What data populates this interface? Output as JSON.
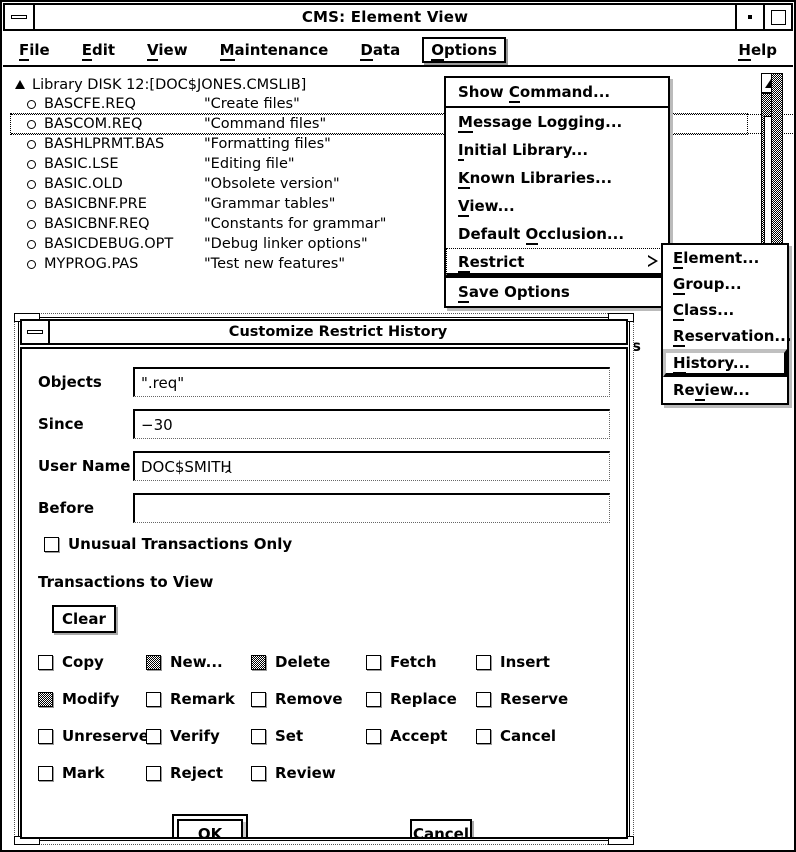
{
  "main_window": {
    "title": "CMS: Element View",
    "window_menu_icon": "window-menu-icon",
    "minimize_icon": "minimize-icon",
    "maximize_icon": "maximize-icon",
    "menubar": [
      {
        "label": "File",
        "mnemonic": "F"
      },
      {
        "label": "Edit",
        "mnemonic": "E"
      },
      {
        "label": "View",
        "mnemonic": "V"
      },
      {
        "label": "Maintenance",
        "mnemonic": "M"
      },
      {
        "label": "Data",
        "mnemonic": "D"
      },
      {
        "label": "Options",
        "mnemonic": "O",
        "active": true
      },
      {
        "label": "Help",
        "mnemonic": "H"
      }
    ],
    "library": {
      "label": "Library DISK 12:[DOC$JONES.CMSLIB]",
      "expander_icon": "triangle-expander-icon"
    },
    "files": [
      {
        "name": "BASCFE.REQ",
        "desc": "\"Create files\"",
        "selected": false
      },
      {
        "name": "BASCOM.REQ",
        "desc": "\"Command files\"",
        "selected": true
      },
      {
        "name": "BASHLPRMT.BAS",
        "desc": "\"Formatting files\"",
        "selected": false
      },
      {
        "name": "BASIC.LSE",
        "desc": "\"Editing file\"",
        "selected": false
      },
      {
        "name": "BASIC.OLD",
        "desc": "\"Obsolete version\"",
        "selected": false
      },
      {
        "name": "BASICBNF.PRE",
        "desc": "\"Grammar tables\"",
        "selected": false
      },
      {
        "name": "BASICBNF.REQ",
        "desc": "\"Constants for grammar\"",
        "selected": false
      },
      {
        "name": "BASICDEBUG.OPT",
        "desc": "\"Debug linker options\"",
        "selected": false
      },
      {
        "name": "MYPROG.PAS",
        "desc": "\"Test new features\"",
        "selected": false
      }
    ],
    "scrollbar": {
      "up_arrow_icon": "scroll-up-arrow-icon",
      "down_arrow_icon": "scroll-down-arrow-icon"
    }
  },
  "options_menu": {
    "items": [
      {
        "label": "Show Command...",
        "mnemonic": "C"
      },
      {
        "label": "Message Logging...",
        "mnemonic": "M"
      },
      {
        "label": "Initial Library...",
        "mnemonic": "I"
      },
      {
        "label": "Known Libraries...",
        "mnemonic": "K"
      },
      {
        "label": "View...",
        "mnemonic": "V"
      },
      {
        "label": "Default Occlusion...",
        "mnemonic": "O"
      },
      {
        "label": "Restrict",
        "mnemonic": "R",
        "submenu_icon": "submenu-arrow-icon"
      },
      {
        "label": "Save Options",
        "mnemonic": "S"
      }
    ]
  },
  "restrict_submenu": {
    "items": [
      {
        "label": "Element...",
        "mnemonic": "E"
      },
      {
        "label": "Group...",
        "mnemonic": "G"
      },
      {
        "label": "Class...",
        "mnemonic": "C"
      },
      {
        "label": "Reservation...",
        "mnemonic": "R"
      },
      {
        "label": "History...",
        "mnemonic": "H",
        "highlighted": true
      },
      {
        "label": "Review...",
        "mnemonic": "v"
      }
    ]
  },
  "occluded_text": "s",
  "dialog": {
    "title": "Customize Restrict History",
    "window_menu_icon": "window-menu-icon",
    "fields": [
      {
        "label": "Objects",
        "value": "\".req\"",
        "placeholder": ""
      },
      {
        "label": "Since",
        "value": "−30",
        "placeholder": ""
      },
      {
        "label": "User Name",
        "value": "DOC$SMITH",
        "placeholder": "",
        "caret": "^"
      },
      {
        "label": "Before",
        "value": "",
        "placeholder": ""
      }
    ],
    "unusual_only": {
      "label": "Unusual Transactions Only",
      "checked": false
    },
    "transactions_heading": "Transactions to View",
    "clear_label": "Clear",
    "transactions": [
      {
        "label": "Copy",
        "checked": false
      },
      {
        "label": "New...",
        "checked": true
      },
      {
        "label": "Delete",
        "checked": true
      },
      {
        "label": "Fetch",
        "checked": false
      },
      {
        "label": "Insert",
        "checked": false
      },
      {
        "label": "Modify",
        "checked": true
      },
      {
        "label": "Remark",
        "checked": false
      },
      {
        "label": "Remove",
        "checked": false
      },
      {
        "label": "Replace",
        "checked": false
      },
      {
        "label": "Reserve",
        "checked": false
      },
      {
        "label": "Unreserve",
        "checked": false
      },
      {
        "label": "Verify",
        "checked": false
      },
      {
        "label": "Set",
        "checked": false
      },
      {
        "label": "Accept",
        "checked": false
      },
      {
        "label": "Cancel",
        "checked": false
      },
      {
        "label": "Mark",
        "checked": false
      },
      {
        "label": "Reject",
        "checked": false
      },
      {
        "label": "Review",
        "checked": false
      },
      {
        "label": "",
        "checked": false
      },
      {
        "label": "",
        "checked": false
      }
    ],
    "ok_label": "OK",
    "cancel_label": "Cancel"
  },
  "colors": {
    "background": "#ffffff",
    "foreground": "#000000",
    "shadow": "#bbbbbb",
    "highlight": "#c0c0c0"
  }
}
